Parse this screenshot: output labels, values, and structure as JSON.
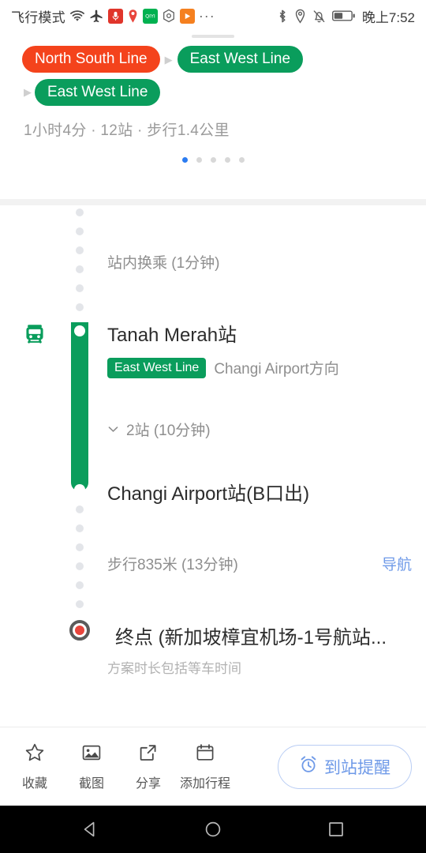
{
  "status_bar": {
    "carrier_label": "飞行模式",
    "time": "晚上7:52",
    "left_icons": [
      "wifi-icon",
      "airplane-icon",
      "microphone-app-icon",
      "location-pin-app-icon",
      "qiyi-app-icon",
      "hexagon-app-icon",
      "video-play-app-icon",
      "overflow-dots-icon"
    ],
    "right_icons": [
      "bluetooth-icon",
      "location-icon",
      "silent-bell-icon",
      "battery-icon"
    ],
    "overflow": "···"
  },
  "route_header": {
    "legs_row1": [
      {
        "label": "North South Line",
        "color": "#f4431c"
      },
      {
        "label": "East West Line",
        "color": "#0a9d5c"
      }
    ],
    "legs_row2": [
      {
        "label": "East West Line",
        "color": "#0a9d5c"
      }
    ],
    "summary": "1小时4分 · 12站 · 步行1.4公里",
    "pager": {
      "count": 5,
      "active_index": 0
    }
  },
  "steps": {
    "transfer_note": "站内换乘 (1分钟)",
    "board_station": {
      "name": "Tanah Merah站",
      "line_chip": "East West Line",
      "direction": "Changi Airport方向"
    },
    "ride_collapse": "2站 (10分钟)",
    "alight_station": {
      "name": "Changi Airport站(B口出)"
    },
    "walk": {
      "text": "步行835米 (13分钟)",
      "action": "导航"
    },
    "destination": {
      "title": "终点 (新加坡樟宜机场-1号航站...",
      "note": "方案时长包括等车时间"
    }
  },
  "toolbar": {
    "items": [
      {
        "label": "收藏",
        "icon": "star-icon"
      },
      {
        "label": "截图",
        "icon": "image-icon"
      },
      {
        "label": "分享",
        "icon": "share-icon"
      },
      {
        "label": "添加行程",
        "icon": "calendar-icon"
      }
    ],
    "remind_button": "到站提醒"
  },
  "nav_bar": {
    "back": "back-triangle-icon",
    "home": "home-circle-icon",
    "recents": "recents-square-icon"
  },
  "colors": {
    "line_red": "#f4431c",
    "line_green": "#0a9d5c",
    "accent_blue": "#6f9ae8",
    "pager_active": "#2b7cf1",
    "destination_red": "#e8453c"
  }
}
